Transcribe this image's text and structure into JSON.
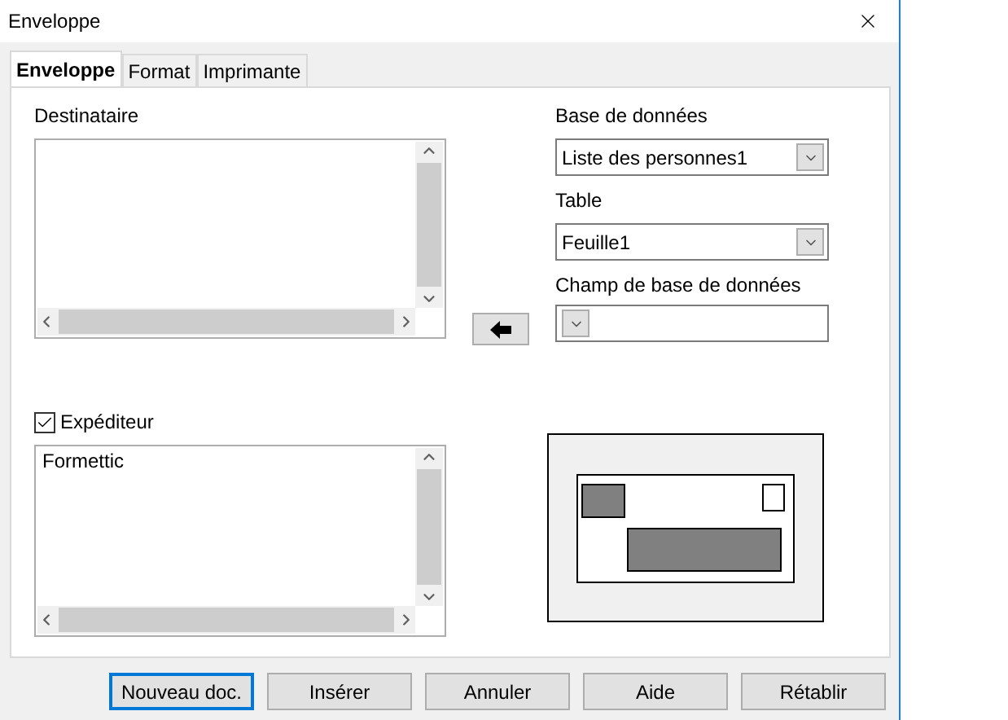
{
  "window": {
    "title": "Enveloppe"
  },
  "tabs": [
    {
      "label": "Enveloppe",
      "selected": true
    },
    {
      "label": "Format",
      "selected": false
    },
    {
      "label": "Imprimante",
      "selected": false
    }
  ],
  "recipient": {
    "label": "Destinataire"
  },
  "database": {
    "label": "Base de données",
    "value": "Liste des personnes1"
  },
  "table": {
    "label": "Table",
    "value": "Feuille1"
  },
  "field": {
    "label": "Champ de base de données"
  },
  "sender": {
    "label": "Expéditeur",
    "checked": true,
    "text": "Formettic"
  },
  "buttons": [
    {
      "label": "Nouveau doc.",
      "focused": true
    },
    {
      "label": "Insérer",
      "focused": false
    },
    {
      "label": "Annuler",
      "focused": false
    },
    {
      "label": "Aide",
      "focused": false
    },
    {
      "label": "Rétablir",
      "focused": false
    }
  ]
}
